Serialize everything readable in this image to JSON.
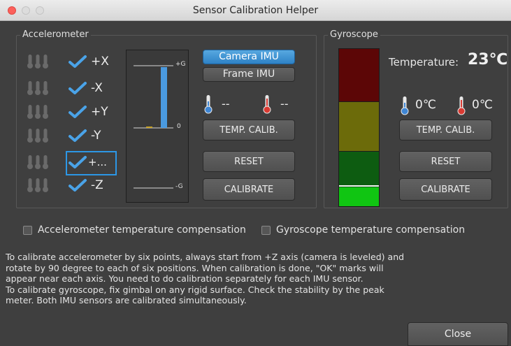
{
  "window": {
    "title": "Sensor Calibration Helper"
  },
  "accelerometer": {
    "group_label": "Accelerometer",
    "axes": [
      {
        "label": "+X",
        "checked": true
      },
      {
        "label": "-X",
        "checked": true
      },
      {
        "label": "+Y",
        "checked": true
      },
      {
        "label": "-Y",
        "checked": true
      },
      {
        "label": "+...",
        "checked": true,
        "selected": true
      },
      {
        "label": "-Z",
        "checked": true
      }
    ],
    "meter": {
      "top_label": "+G",
      "middle_label": "0",
      "bottom_label": "-G"
    },
    "imu_buttons": {
      "camera_imu": "Camera IMU",
      "frame_imu": "Frame IMU"
    },
    "temperatures": {
      "cold_value": "--",
      "hot_value": "--"
    },
    "temp_calib_label": "TEMP. CALIB.",
    "reset_label": "RESET",
    "calibrate_label": "CALIBRATE"
  },
  "gyroscope": {
    "group_label": "Gyroscope",
    "temperature_label": "Temperature:",
    "temperature_value": "23℃",
    "peak_level": 0.12,
    "temperatures": {
      "cold_value": "0℃",
      "hot_value": "0℃"
    },
    "temp_calib_label": "TEMP. CALIB.",
    "reset_label": "RESET",
    "calibrate_label": "CALIBRATE"
  },
  "options": {
    "accel_comp_label": "Accelerometer temperature compensation",
    "gyro_comp_label": "Gyroscope temperature compensation",
    "accel_comp_checked": false,
    "gyro_comp_checked": false
  },
  "info_lines": [
    "To calibrate accelerometer by six points, always start from +Z axis (camera is leveled) and",
    "rotate by 90 degree to each of six positions. When calibration is done, \"OK\" marks will",
    "appear near each axis. You need to do calibration separately for each IMU sensor.",
    "To calibrate gyroscope, fix gimbal on any rigid surface. Check the stability by the peak",
    "meter. Both IMU sensors are calibrated simultaneously."
  ],
  "close_label": "Close",
  "colors": {
    "accent_blue": "#2c97e6",
    "check_blue": "#4aa3e8",
    "peak_dark_red": "#5c0606",
    "peak_olive": "#6c6b0a",
    "peak_dark_green": "#0d5c11",
    "peak_green": "#10c512"
  }
}
